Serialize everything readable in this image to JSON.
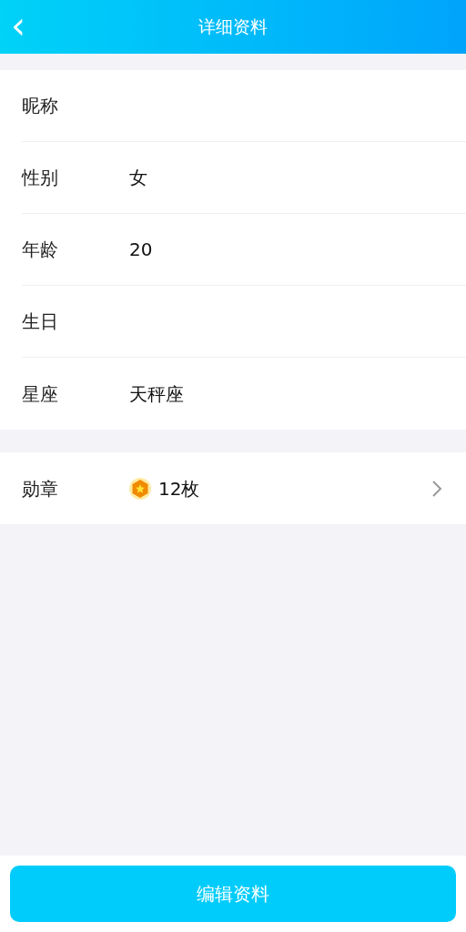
{
  "header": {
    "back": "‹",
    "title": "详细资料"
  },
  "fields": [
    {
      "label": "昵称"
    },
    {
      "label": "性别",
      "value": "女"
    },
    {
      "label": "年龄",
      "value": "20"
    },
    {
      "label": "生日"
    },
    {
      "label": "星座",
      "value": "天秤座"
    }
  ],
  "medals": {
    "label": "勋章",
    "value": "12枚"
  },
  "edit_button": "编辑资料"
}
